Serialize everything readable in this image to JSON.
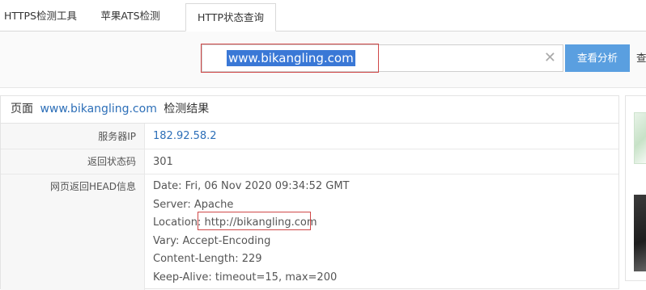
{
  "tabs": [
    {
      "label": "HTTPS检测工具"
    },
    {
      "label": "苹果ATS检测"
    },
    {
      "label": "HTTP状态查询"
    }
  ],
  "search": {
    "value": "www.bikangling.com",
    "clear_icon": "close-icon",
    "button_label": "查看分析",
    "button2_label": "查"
  },
  "result": {
    "prefix": "页面",
    "domain": "www.bikangling.com",
    "suffix": "检测结果",
    "rows": [
      {
        "key": "服务器IP",
        "value": "182.92.58.2"
      },
      {
        "key": "返回状态码",
        "value": "301"
      },
      {
        "key": "网页返回HEAD信息",
        "lines": [
          "Date: Fri, 06 Nov 2020 09:34:52 GMT",
          "Server: Apache",
          "Location: http://bikangling.com",
          "Vary: Accept-Encoding",
          "Content-Length: 229",
          "Keep-Alive: timeout=15, max=200"
        ]
      }
    ]
  },
  "colors": {
    "accent": "#5a9fe0",
    "link": "#2d6fb8",
    "highlight_box": "#d04848",
    "selection": "#3a78d6"
  }
}
